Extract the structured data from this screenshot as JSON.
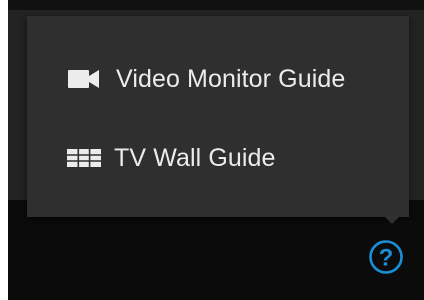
{
  "help_menu": {
    "items": [
      {
        "label": "Video Monitor Guide",
        "icon": "video-camera-icon"
      },
      {
        "label": "TV Wall Guide",
        "icon": "tv-wall-grid-icon"
      }
    ]
  },
  "help_button": {
    "label": "?",
    "icon": "help-circle-icon"
  },
  "colors": {
    "popover_background": "#2f2f2f",
    "menu_text": "#ececec",
    "accent": "#1a8fd6",
    "app_background": "#0b0b0b",
    "panel_background": "#232323"
  }
}
